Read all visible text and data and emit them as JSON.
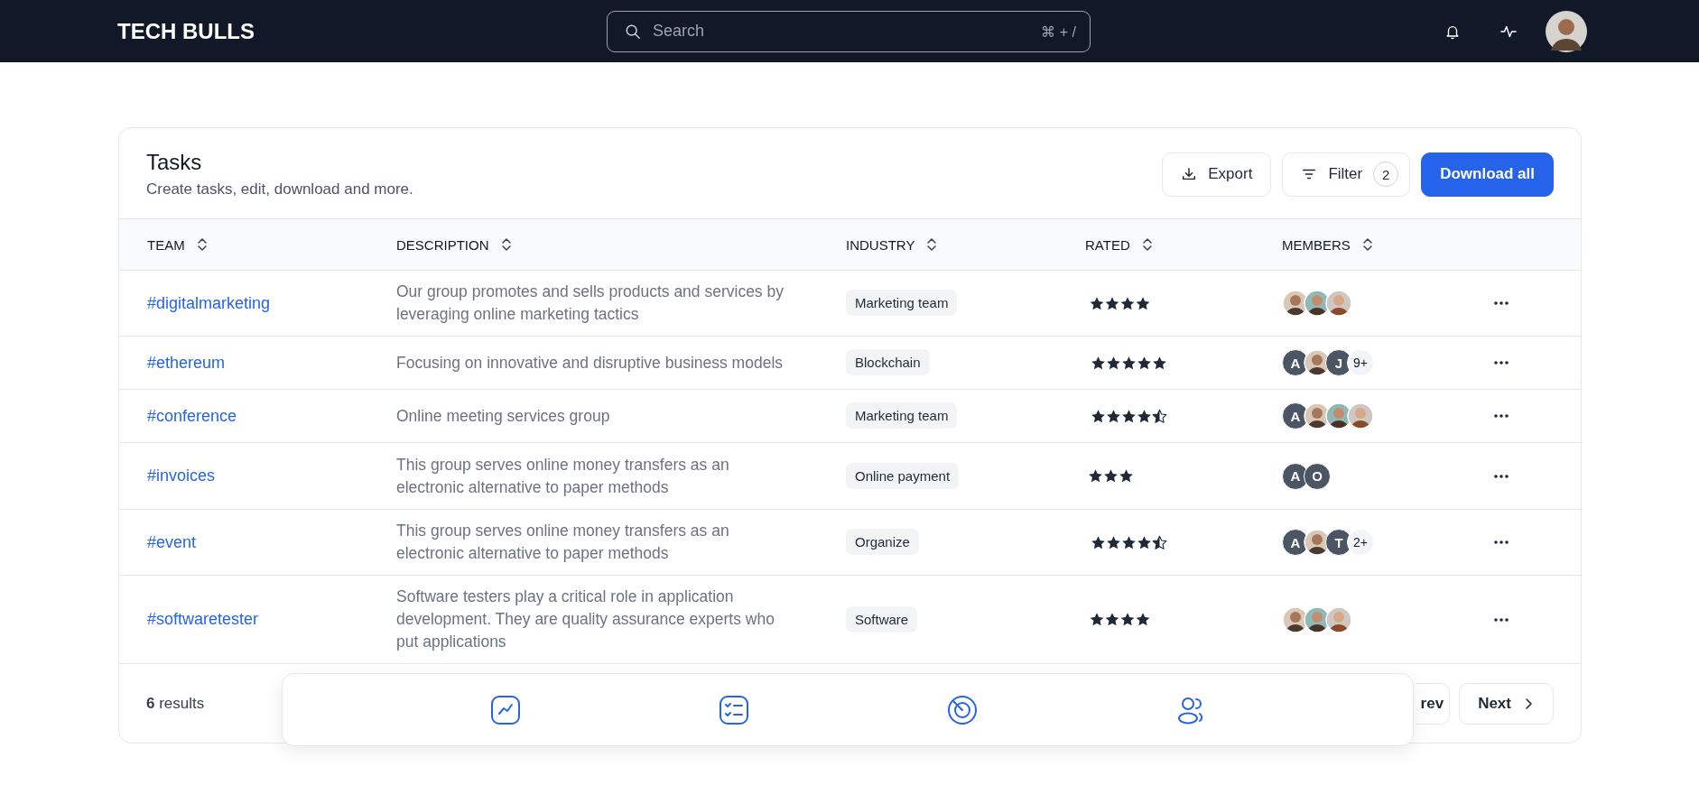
{
  "header": {
    "logo": "TECH BULLS",
    "search": {
      "placeholder": "Search",
      "shortcut": "⌘ + /"
    }
  },
  "card": {
    "title": "Tasks",
    "subtitle": "Create tasks, edit, download and more.",
    "actions": {
      "export": "Export",
      "filter": "Filter",
      "filter_count": "2",
      "download": "Download all"
    }
  },
  "table": {
    "columns": [
      "TEAM",
      "DESCRIPTION",
      "INDUSTRY",
      "RATED",
      "MEMBERS"
    ],
    "rows": [
      {
        "team": "#digitalmarketing",
        "description": "Our group promotes and sells products and services by leveraging online marketing tactics",
        "industry": "Marketing team",
        "stars": 4,
        "members": [
          {
            "kind": "photo"
          },
          {
            "kind": "photo"
          },
          {
            "kind": "photo"
          }
        ]
      },
      {
        "team": "#ethereum",
        "description": "Focusing on innovative and disruptive business models",
        "industry": "Blockchain",
        "stars": 5,
        "members": [
          {
            "kind": "initial",
            "text": "A"
          },
          {
            "kind": "photo"
          },
          {
            "kind": "initial",
            "text": "J"
          },
          {
            "kind": "more",
            "text": "9+"
          }
        ]
      },
      {
        "team": "#conference",
        "description": "Online meeting services group",
        "industry": "Marketing team",
        "stars": 4.5,
        "members": [
          {
            "kind": "initial",
            "text": "A"
          },
          {
            "kind": "photo"
          },
          {
            "kind": "photo"
          },
          {
            "kind": "photo"
          }
        ]
      },
      {
        "team": "#invoices",
        "description": "This group serves online money transfers as an electronic alternative to paper methods",
        "industry": "Online payment",
        "stars": 3,
        "members": [
          {
            "kind": "initial",
            "text": "A"
          },
          {
            "kind": "initial",
            "text": "O"
          }
        ]
      },
      {
        "team": "#event",
        "description": "This group serves online money transfers as an electronic alternative to paper methods",
        "industry": "Organize",
        "stars": 4.5,
        "members": [
          {
            "kind": "initial",
            "text": "A"
          },
          {
            "kind": "photo"
          },
          {
            "kind": "initial",
            "text": "T"
          },
          {
            "kind": "more",
            "text": "2+"
          }
        ]
      },
      {
        "team": "#softwaretester",
        "description": "Software testers play a critical role in application development. They are quality assurance experts who put applications",
        "industry": "Software",
        "stars": 4,
        "members": [
          {
            "kind": "photo"
          },
          {
            "kind": "photo"
          },
          {
            "kind": "photo"
          }
        ]
      }
    ]
  },
  "footer": {
    "count": "6",
    "count_label": "results",
    "prev": "rev",
    "next": "Next"
  },
  "dock": [
    {
      "kind": "chart"
    },
    {
      "kind": "checklist"
    },
    {
      "kind": "target"
    },
    {
      "kind": "users"
    }
  ]
}
